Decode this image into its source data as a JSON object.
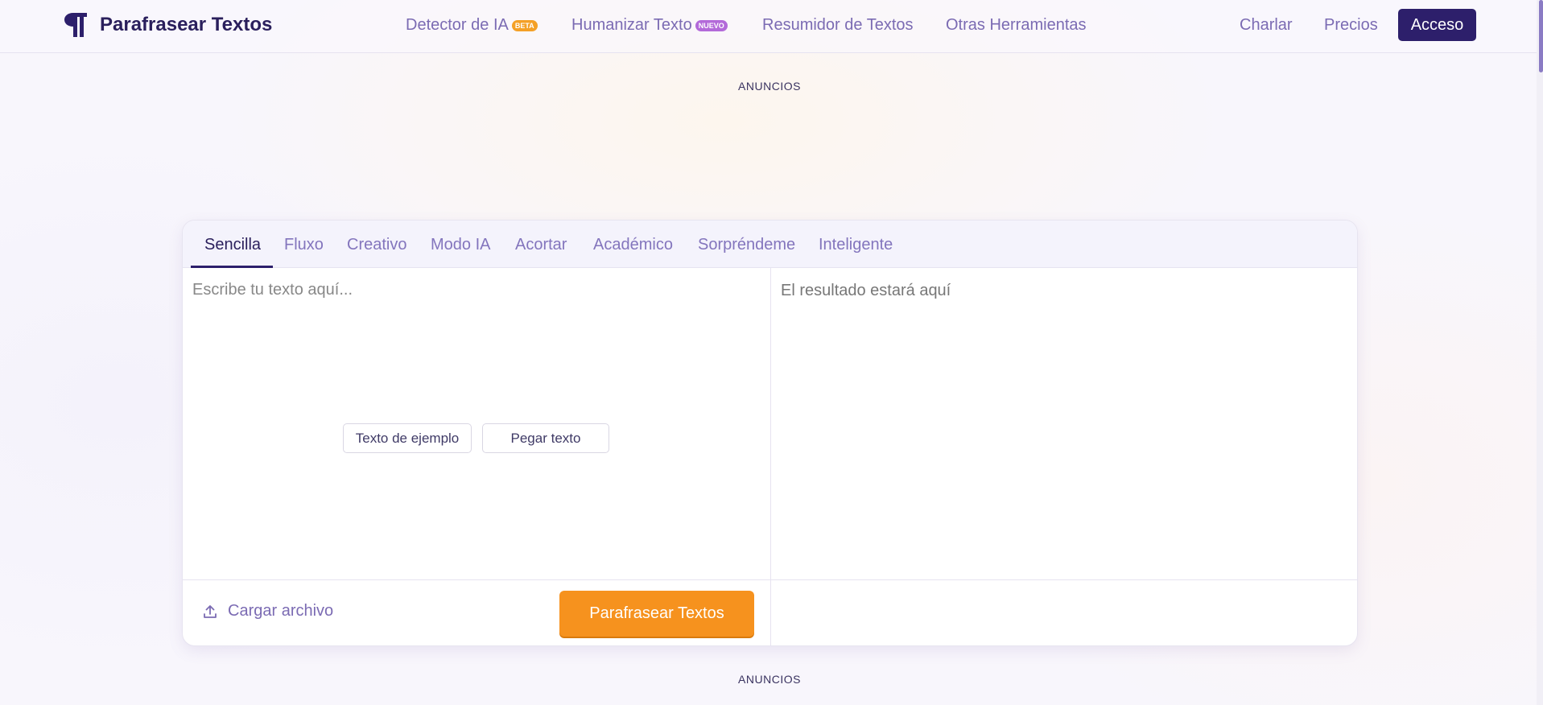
{
  "header": {
    "logo_text": "Parafrasear Textos",
    "nav": [
      {
        "label": "Detector de IA",
        "badge": "BETA"
      },
      {
        "label": "Humanizar Texto",
        "badge": "NUEVO"
      },
      {
        "label": "Resumidor de Textos"
      },
      {
        "label": "Otras Herramientas"
      }
    ],
    "right": {
      "chat": "Charlar",
      "pricing": "Precios",
      "login": "Acceso"
    }
  },
  "ads": {
    "top": "ANUNCIOS",
    "bottom": "ANUNCIOS"
  },
  "tool": {
    "tabs": [
      "Sencilla",
      "Fluxo",
      "Creativo",
      "Modo IA",
      "Acortar",
      "Académico",
      "Sorpréndeme",
      "Inteligente"
    ],
    "active_tab": "Sencilla",
    "input_placeholder": "Escribe tu texto aquí...",
    "input_value": "",
    "output_placeholder": "El resultado estará aquí",
    "sample_button": "Texto de ejemplo",
    "paste_button": "Pegar texto",
    "upload_label": "Cargar archivo",
    "submit_button": "Parafrasear Textos"
  },
  "colors": {
    "brand": "#2d1f6b",
    "accent": "#f6921e",
    "link": "#7b6bb3",
    "beta_badge": "#f4a026",
    "new_badge": "#b36ad9"
  },
  "icons": {
    "logo": "pilcrow-icon",
    "upload": "upload-icon"
  }
}
